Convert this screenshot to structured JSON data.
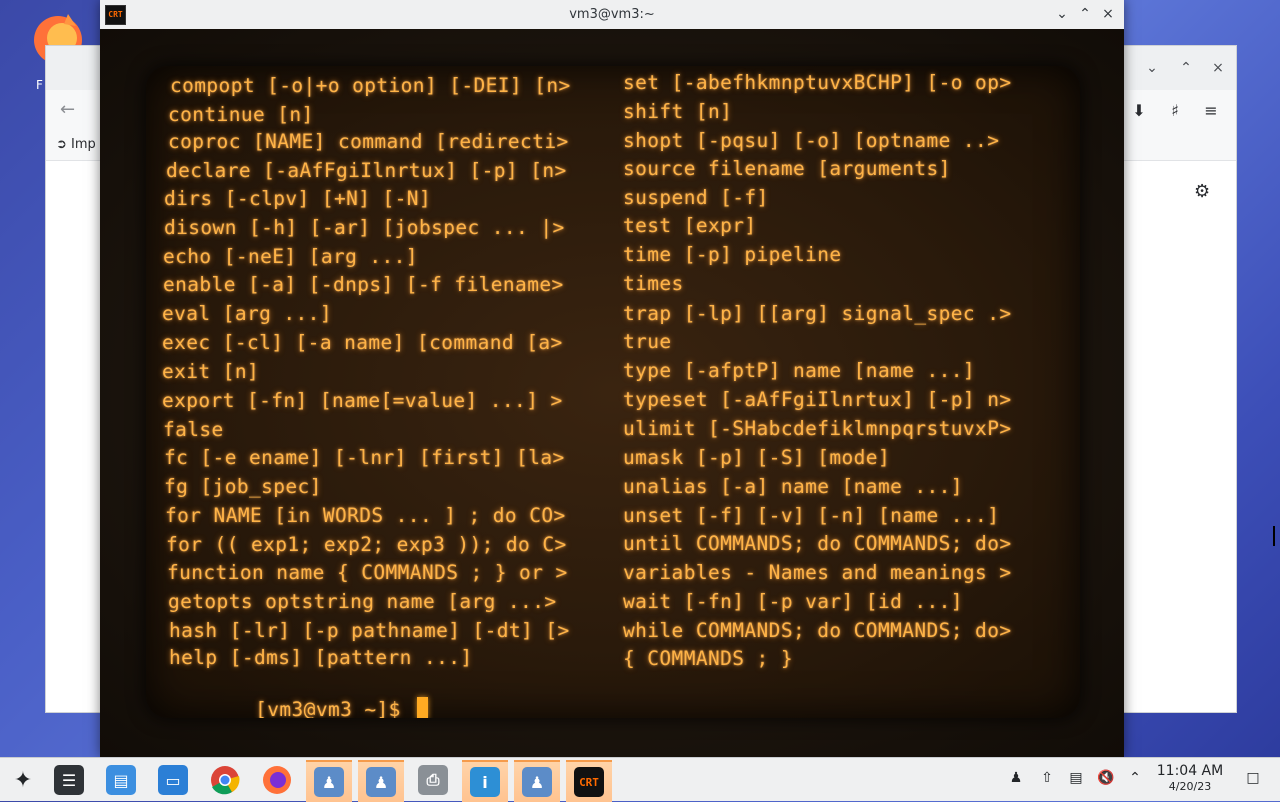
{
  "desktop": {
    "icon_label": "F"
  },
  "background_window": {
    "bookmark_label": "Imp",
    "controls": [
      "⌄",
      "⌃",
      "×"
    ]
  },
  "terminal_window": {
    "app_icon_text": "CRT",
    "title": "vm3@vm3:~",
    "left_column": [
      "compopt [-o|+o option] [-DEI] [n>",
      "continue [n]",
      "coproc [NAME] command [redirecti>",
      "declare [-aAfFgiIlnrtux] [-p] [n>",
      "dirs [-clpv] [+N] [-N]",
      "disown [-h] [-ar] [jobspec ... |>",
      "echo [-neE] [arg ...]",
      "enable [-a] [-dnps] [-f filename>",
      "eval [arg ...]",
      "exec [-cl] [-a name] [command [a>",
      "exit [n]",
      "export [-fn] [name[=value] ...] >",
      "false",
      "fc [-e ename] [-lnr] [first] [la>",
      "fg [job_spec]",
      "for NAME [in WORDS ... ] ; do CO>",
      "for (( exp1; exp2; exp3 )); do C>",
      "function name { COMMANDS ; } or >",
      "getopts optstring name [arg ...>",
      "hash [-lr] [-p pathname] [-dt] [>",
      "help [-dms] [pattern ...]"
    ],
    "right_column": [
      "set [-abefhkmnptuvxBCHP] [-o op>",
      "shift [n]",
      "shopt [-pqsu] [-o] [optname ..>",
      "source filename [arguments]",
      "suspend [-f]",
      "test [expr]",
      "time [-p] pipeline",
      "times",
      "trap [-lp] [[arg] signal_spec .>",
      "true",
      "type [-afptP] name [name ...]",
      "typeset [-aAfFgiIlnrtux] [-p] n>",
      "ulimit [-SHabcdefiklmnpqrstuvxP>",
      "umask [-p] [-S] [mode]",
      "unalias [-a] name [name ...]",
      "unset [-f] [-v] [-n] [name ...]",
      "until COMMANDS; do COMMANDS; do>",
      "variables - Names and meanings >",
      "wait [-fn] [-p var] [id ...]",
      "while COMMANDS; do COMMANDS; do>",
      "{ COMMANDS ; }"
    ],
    "prompt": "[vm3@vm3 ~]$ "
  },
  "taskbar": {
    "crt_icon_text": "CRT",
    "clock_time": "11:04 AM",
    "clock_date": "4/20/23"
  },
  "colors": {
    "crt_text": "#ffb347",
    "taskbar_active": "#ffc390"
  }
}
